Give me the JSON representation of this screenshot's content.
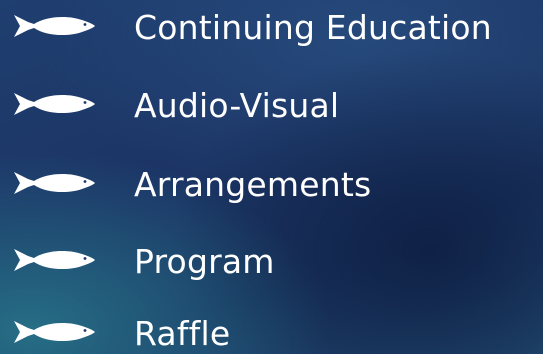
{
  "menu": {
    "items": [
      {
        "label": "Continuing Education",
        "icon": "fish-icon"
      },
      {
        "label": "Audio-Visual",
        "icon": "fish-icon"
      },
      {
        "label": "Arrangements",
        "icon": "fish-icon"
      },
      {
        "label": "Program",
        "icon": "fish-icon"
      },
      {
        "label": "Raffle",
        "icon": "fish-icon"
      }
    ]
  },
  "colors": {
    "text": "#ffffff",
    "icon": "#ffffff",
    "background": "#1c3566",
    "background_accent": "#2a7a8c"
  }
}
